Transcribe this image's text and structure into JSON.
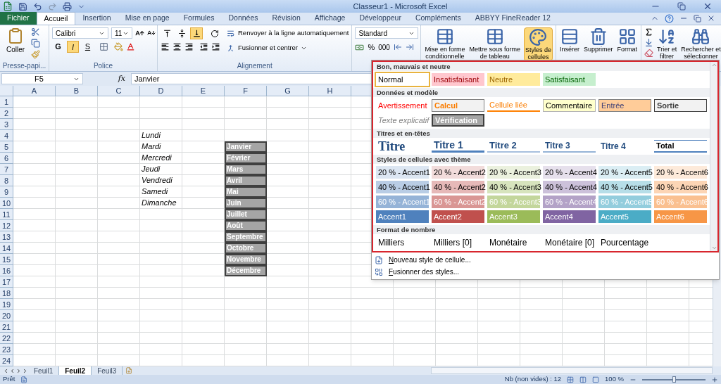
{
  "window": {
    "title": "Classeur1 - Microsoft Excel"
  },
  "ribbon_tabs": [
    {
      "label": "Fichier",
      "kind": "file",
      "selected": false
    },
    {
      "label": "Accueil",
      "kind": "tab",
      "selected": true
    },
    {
      "label": "Insertion",
      "kind": "tab",
      "selected": false
    },
    {
      "label": "Mise en page",
      "kind": "tab",
      "selected": false
    },
    {
      "label": "Formules",
      "kind": "tab",
      "selected": false
    },
    {
      "label": "Données",
      "kind": "tab",
      "selected": false
    },
    {
      "label": "Révision",
      "kind": "tab",
      "selected": false
    },
    {
      "label": "Affichage",
      "kind": "tab",
      "selected": false
    },
    {
      "label": "Développeur",
      "kind": "tab",
      "selected": false
    },
    {
      "label": "Compléments",
      "kind": "tab",
      "selected": false
    },
    {
      "label": "ABBYY FineReader 12",
      "kind": "tab",
      "selected": false
    }
  ],
  "clipboard": {
    "paste": "Coller",
    "group_label": "Presse-papi..."
  },
  "font": {
    "name": "Calibri",
    "size": "11",
    "group_label": "Police",
    "format_buttons": [
      {
        "label": "G",
        "kind": "bold",
        "selected": false
      },
      {
        "label": "I",
        "kind": "italic",
        "selected": true
      },
      {
        "label": "S",
        "kind": "underline",
        "selected": false
      }
    ]
  },
  "alignment": {
    "group_label": "Alignement",
    "wrap": "Renvoyer à la ligne automatiquement",
    "merge": "Fusionner et centrer",
    "vertical_buttons": [
      {
        "kind": "top",
        "selected": false
      },
      {
        "kind": "middle",
        "selected": false
      },
      {
        "kind": "bottom",
        "selected": true
      }
    ]
  },
  "number": {
    "format": "Standard",
    "percent": "%",
    "thousands": "000"
  },
  "styles_buttons": [
    {
      "lines": [
        "Mise en forme",
        "conditionnelle"
      ],
      "kind": "conditional",
      "selected": false
    },
    {
      "lines": [
        "Mettre sous forme",
        "de tableau"
      ],
      "kind": "table",
      "selected": false
    },
    {
      "lines": [
        "Styles de",
        "cellules"
      ],
      "kind": "styles",
      "selected": true
    }
  ],
  "cells_buttons": [
    {
      "label": "Insérer",
      "kind": "insert"
    },
    {
      "label": "Supprimer",
      "kind": "delete"
    },
    {
      "label": "Format",
      "kind": "format"
    }
  ],
  "editing_buttons": [
    {
      "lines": [
        "Trier et",
        "filtrer"
      ],
      "kind": "sort"
    },
    {
      "lines": [
        "Rechercher et",
        "sélectionner"
      ],
      "kind": "find"
    }
  ],
  "formula_bar": {
    "name_box": "F5",
    "fx": "fx",
    "value": "Janvier"
  },
  "sheet": {
    "columns": [
      "A",
      "B",
      "C",
      "D",
      "E",
      "F",
      "G",
      "H"
    ],
    "rows": [
      {
        "number": "1"
      },
      {
        "number": "2"
      },
      {
        "number": "3"
      },
      {
        "number": "4",
        "col_d": "Lundi"
      },
      {
        "number": "5",
        "col_d": "Mardi",
        "col_f": "Janvier"
      },
      {
        "number": "6",
        "col_d": "Mercredi",
        "col_f": "Février"
      },
      {
        "number": "7",
        "col_d": "Jeudi",
        "col_f": "Mars"
      },
      {
        "number": "8",
        "col_d": "Vendredi",
        "col_f": "Avril"
      },
      {
        "number": "9",
        "col_d": "Samedi",
        "col_f": "Mai"
      },
      {
        "number": "10",
        "col_d": "Dimanche",
        "col_f": "Juin"
      },
      {
        "number": "11",
        "col_f": "Juillet"
      },
      {
        "number": "12",
        "col_f": "Août"
      },
      {
        "number": "13",
        "col_f": "Septembre"
      },
      {
        "number": "14",
        "col_f": "Octobre"
      },
      {
        "number": "15",
        "col_f": "Novembre"
      },
      {
        "number": "16",
        "col_f": "Décembre"
      },
      {
        "number": "17"
      },
      {
        "number": "18"
      },
      {
        "number": "19"
      },
      {
        "number": "20"
      },
      {
        "number": "21"
      },
      {
        "number": "22"
      },
      {
        "number": "23"
      },
      {
        "number": "24"
      }
    ]
  },
  "cell_styles": {
    "sections": [
      {
        "title": "Bon, mauvais et neutre",
        "items": [
          {
            "label": "Normal",
            "kind": "normal",
            "selected": true
          },
          {
            "label": "Insatisfaisant",
            "kind": "bad",
            "selected": false
          },
          {
            "label": "Neutre",
            "kind": "neutral",
            "selected": false
          },
          {
            "label": "Satisfaisant",
            "kind": "good",
            "selected": false
          }
        ]
      },
      {
        "title": "Données et modèle",
        "items": [
          {
            "label": "Avertissement",
            "kind": "warning",
            "selected": false
          },
          {
            "label": "Calcul",
            "kind": "calc",
            "selected": false
          },
          {
            "label": "Cellule liée",
            "kind": "linked",
            "selected": false
          },
          {
            "label": "Commentaire",
            "kind": "note",
            "selected": false
          },
          {
            "label": "Entrée",
            "kind": "input",
            "selected": false
          },
          {
            "label": "Sortie",
            "kind": "output",
            "selected": false
          },
          {
            "label": "Texte explicatif",
            "kind": "explanatory",
            "selected": false
          },
          {
            "label": "Vérification",
            "kind": "check",
            "selected": false
          }
        ]
      },
      {
        "title": "Titres et en-têtes",
        "items": [
          {
            "label": "Titre",
            "kind": "title",
            "selected": false
          },
          {
            "label": "Titre 1",
            "kind": "h1",
            "selected": false
          },
          {
            "label": "Titre 2",
            "kind": "h2",
            "selected": false
          },
          {
            "label": "Titre 3",
            "kind": "h3",
            "selected": false
          },
          {
            "label": "Titre 4",
            "kind": "h4",
            "selected": false
          },
          {
            "label": "Total",
            "kind": "total",
            "selected": false
          }
        ]
      },
      {
        "title": "Styles de cellules avec thème",
        "items": [
          {
            "label": "20 % - Accent1",
            "kind": "tint20",
            "color": "#dce6f2",
            "selected": false
          },
          {
            "label": "20 % - Accent2",
            "kind": "tint20",
            "color": "#f2dcdb",
            "selected": false
          },
          {
            "label": "20 % - Accent3",
            "kind": "tint20",
            "color": "#ebf1de",
            "selected": false
          },
          {
            "label": "20 % - Accent4",
            "kind": "tint20",
            "color": "#e6e0ec",
            "selected": false
          },
          {
            "label": "20 % - Accent5",
            "kind": "tint20",
            "color": "#dbeef4",
            "selected": false
          },
          {
            "label": "20 % - Accent6",
            "kind": "tint20",
            "color": "#fdeada",
            "selected": false
          },
          {
            "label": "40 % - Accent1",
            "kind": "tint40",
            "color": "#b9cde5",
            "selected": false
          },
          {
            "label": "40 % - Accent2",
            "kind": "tint40",
            "color": "#e6b9b8",
            "selected": false
          },
          {
            "label": "40 % - Accent3",
            "kind": "tint40",
            "color": "#d7e4bd",
            "selected": false
          },
          {
            "label": "40 % - Accent4",
            "kind": "tint40",
            "color": "#ccc1da",
            "selected": false
          },
          {
            "label": "40 % - Accent5",
            "kind": "tint40",
            "color": "#b7dee8",
            "selected": false
          },
          {
            "label": "40 % - Accent6",
            "kind": "tint40",
            "color": "#fcd5b5",
            "selected": false
          },
          {
            "label": "60 % - Accent1",
            "kind": "tint60",
            "color": "#95b3d7",
            "selected": false
          },
          {
            "label": "60 % - Accent2",
            "kind": "tint60",
            "color": "#d99694",
            "selected": false
          },
          {
            "label": "60 % - Accent3",
            "kind": "tint60",
            "color": "#c3d69b",
            "selected": false
          },
          {
            "label": "60 % - Accent4",
            "kind": "tint60",
            "color": "#b3a2c7",
            "selected": false
          },
          {
            "label": "60 % - Accent5",
            "kind": "tint60",
            "color": "#93cddd",
            "selected": false
          },
          {
            "label": "60 % - Accent6",
            "kind": "tint60",
            "color": "#fac090",
            "selected": false
          },
          {
            "label": "Accent1",
            "kind": "solid",
            "color": "#4f81bd",
            "selected": false
          },
          {
            "label": "Accent2",
            "kind": "solid",
            "color": "#c0504d",
            "selected": false
          },
          {
            "label": "Accent3",
            "kind": "solid",
            "color": "#9bbb59",
            "selected": false
          },
          {
            "label": "Accent4",
            "kind": "solid",
            "color": "#8064a2",
            "selected": false
          },
          {
            "label": "Accent5",
            "kind": "solid",
            "color": "#4bacc6",
            "selected": false
          },
          {
            "label": "Accent6",
            "kind": "solid",
            "color": "#f79646",
            "selected": false
          }
        ]
      },
      {
        "title": "Format de nombre",
        "items": [
          {
            "label": "Milliers",
            "kind": "number",
            "selected": false
          },
          {
            "label": "Milliers [0]",
            "kind": "number",
            "selected": false
          },
          {
            "label": "Monétaire",
            "kind": "number",
            "selected": false
          },
          {
            "label": "Monétaire [0]",
            "kind": "number",
            "selected": false
          },
          {
            "label": "Pourcentage",
            "kind": "number",
            "selected": false
          }
        ]
      }
    ]
  },
  "style_menu": [
    {
      "label": "Nouveau style de cellule...",
      "kind": "new"
    },
    {
      "label": "Fusionner des styles...",
      "kind": "merge"
    }
  ],
  "sheet_tabs": [
    {
      "label": "Feuil1",
      "selected": false
    },
    {
      "label": "Feuil2",
      "selected": true
    },
    {
      "label": "Feuil3",
      "selected": false
    }
  ],
  "status_bar": {
    "mode": "Prêt",
    "count": "Nb (non vides) : 12",
    "zoom": "100 %",
    "zoom_slider": {
      "level": 0.5
    }
  }
}
